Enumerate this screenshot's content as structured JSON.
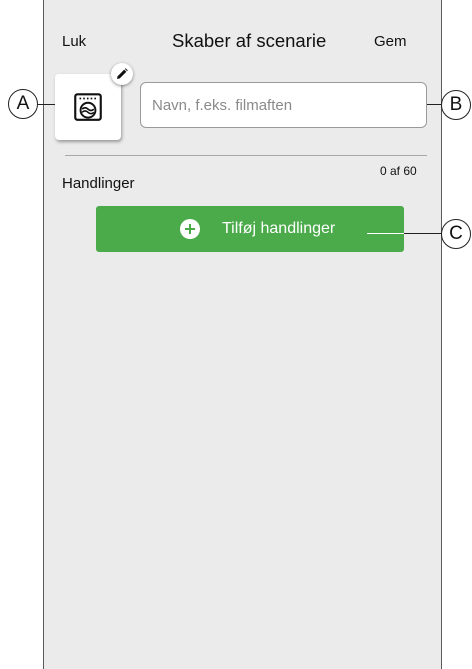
{
  "header": {
    "close_label": "Luk",
    "title": "Skaber af scenarie",
    "save_label": "Gem"
  },
  "scene": {
    "icon": "scene-icon",
    "edit_icon": "pencil-icon",
    "name_placeholder": "Navn, f.eks. filmaften",
    "name_value": ""
  },
  "actions": {
    "heading": "Handlinger",
    "count": "0 af 60",
    "add_icon": "plus-circle-icon",
    "add_button_label": "Tilføj handlinger"
  },
  "callouts": {
    "a": "A",
    "b": "B",
    "c": "C"
  },
  "colors": {
    "accent": "#4bab4b",
    "background": "#ebebeb"
  }
}
